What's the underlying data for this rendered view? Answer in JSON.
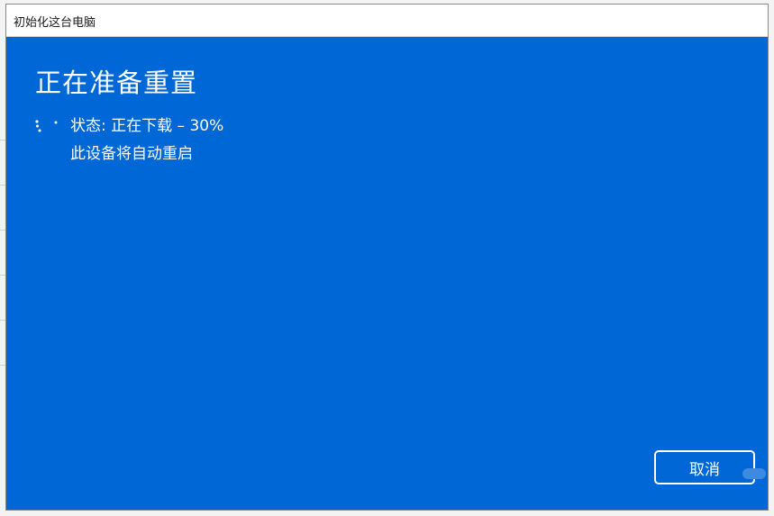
{
  "window": {
    "title": "初始化这台电脑"
  },
  "main": {
    "heading": "正在准备重置",
    "status_text": "状态: 正在下载 – 30%",
    "restart_notice": "此设备将自动重启"
  },
  "progress": {
    "percent": 30
  },
  "actions": {
    "cancel_label": "取消"
  },
  "icons": {
    "spinner": "loading-spinner-icon"
  },
  "colors": {
    "background": "#0067d6",
    "text": "#ffffff",
    "titlebar": "#ffffff"
  }
}
